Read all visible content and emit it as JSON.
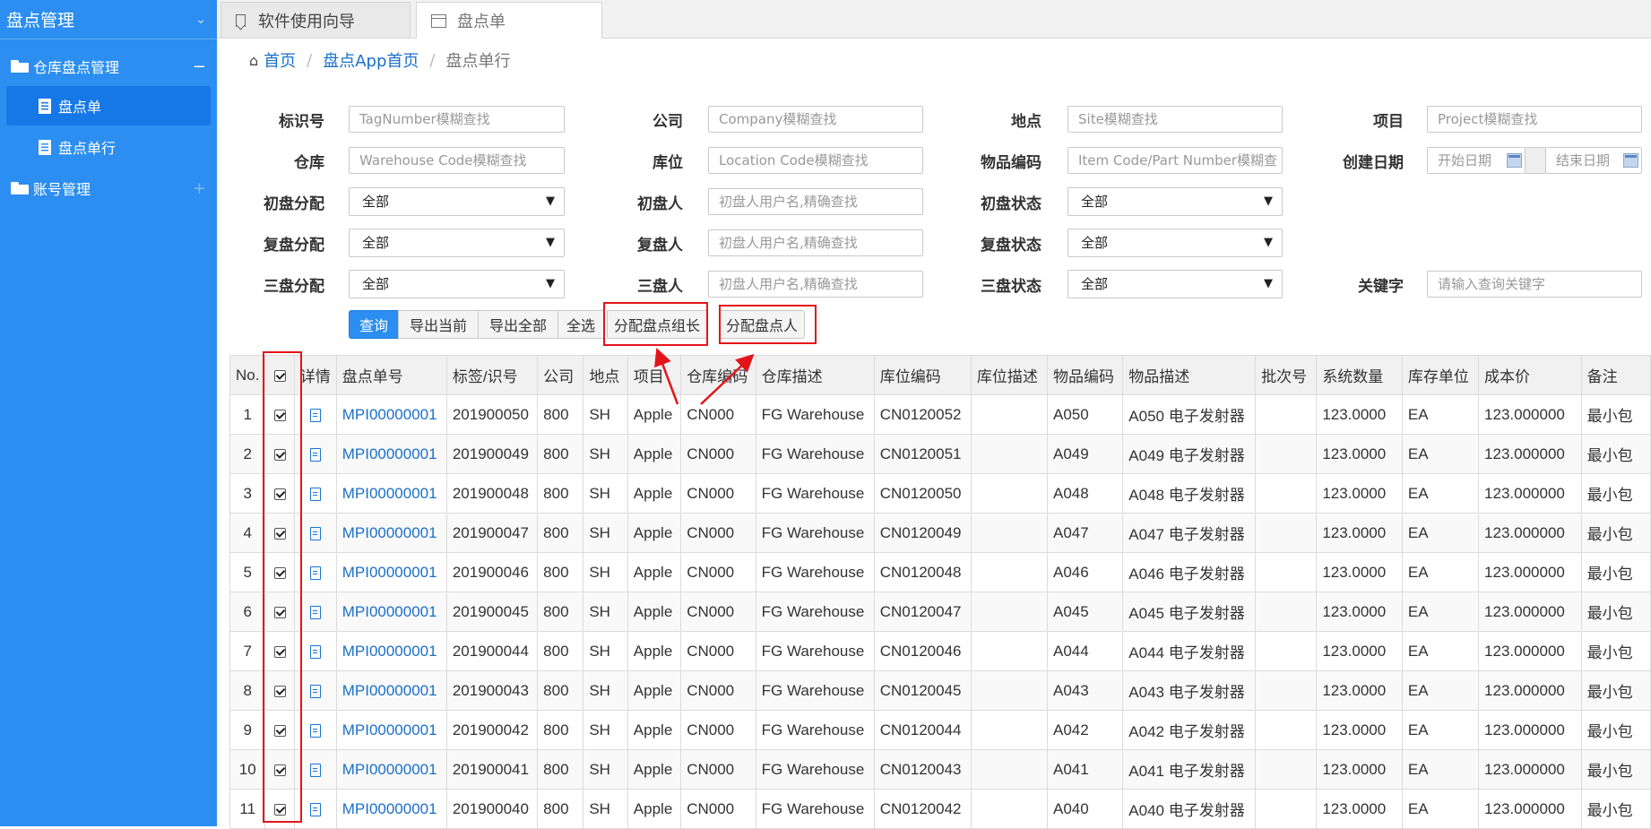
{
  "sidebar": {
    "title": "盘点管理",
    "groups": [
      {
        "label": "仓库盘点管理",
        "sign": "−",
        "items": [
          {
            "label": "盘点单"
          },
          {
            "label": "盘点单行"
          }
        ]
      },
      {
        "label": "账号管理",
        "sign": "+"
      }
    ]
  },
  "tabs": [
    {
      "label": "软件使用向导"
    },
    {
      "label": "盘点单"
    }
  ],
  "breadcrumb": {
    "home": "首页",
    "parent": "盘点App首页",
    "current": "盘点单行"
  },
  "filters": {
    "tag_label": "标识号",
    "tag_ph": "TagNumber模糊查找",
    "company_label": "公司",
    "company_ph": "Company模糊查找",
    "site_label": "地点",
    "site_ph": "Site模糊查找",
    "project_label": "项目",
    "project_ph": "Project模糊查找",
    "warehouse_label": "仓库",
    "warehouse_ph": "Warehouse Code模糊查找",
    "location_label": "库位",
    "location_ph": "Location Code模糊查找",
    "item_label": "物品编码",
    "item_ph": "Item Code/Part Number模糊查",
    "created_label": "创建日期",
    "start_ph": "开始日期",
    "end_ph": "结束日期",
    "first_assign_label": "初盘分配",
    "first_assign_value": "全部",
    "first_user_label": "初盘人",
    "first_user_ph": "初盘人用户名,精确查找",
    "first_status_label": "初盘状态",
    "first_status_value": "全部",
    "second_assign_label": "复盘分配",
    "second_assign_value": "全部",
    "second_user_label": "复盘人",
    "second_user_ph": "初盘人用户名,精确查找",
    "second_status_label": "复盘状态",
    "second_status_value": "全部",
    "third_assign_label": "三盘分配",
    "third_assign_value": "全部",
    "third_user_label": "三盘人",
    "third_user_ph": "初盘人用户名,精确查找",
    "third_status_label": "三盘状态",
    "third_status_value": "全部",
    "keyword_label": "关键字",
    "keyword_ph": "请输入查询关键字"
  },
  "toolbar": {
    "query": "查询",
    "export_current": "导出当前",
    "export_all": "导出全部",
    "select_all": "全选",
    "assign_leader": "分配盘点组长",
    "assign_counter": "分配盘点人"
  },
  "table": {
    "headers": [
      "No.",
      "",
      "详情",
      "盘点单号",
      "标签/识号",
      "公司",
      "地点",
      "项目",
      "仓库编码",
      "仓库描述",
      "库位编码",
      "库位描述",
      "物品编码",
      "物品描述",
      "批次号",
      "系统数量",
      "库存单位",
      "成本价",
      "备注"
    ],
    "rows": [
      [
        "1",
        "MPI00000001",
        "201900050",
        "800",
        "SH",
        "Apple",
        "CN000",
        "FG Warehouse",
        "CN0120052",
        "",
        "A050",
        "A050 电子发射器",
        "",
        "123.0000",
        "EA",
        "123.000000",
        "最小包"
      ],
      [
        "2",
        "MPI00000001",
        "201900049",
        "800",
        "SH",
        "Apple",
        "CN000",
        "FG Warehouse",
        "CN0120051",
        "",
        "A049",
        "A049 电子发射器",
        "",
        "123.0000",
        "EA",
        "123.000000",
        "最小包"
      ],
      [
        "3",
        "MPI00000001",
        "201900048",
        "800",
        "SH",
        "Apple",
        "CN000",
        "FG Warehouse",
        "CN0120050",
        "",
        "A048",
        "A048 电子发射器",
        "",
        "123.0000",
        "EA",
        "123.000000",
        "最小包"
      ],
      [
        "4",
        "MPI00000001",
        "201900047",
        "800",
        "SH",
        "Apple",
        "CN000",
        "FG Warehouse",
        "CN0120049",
        "",
        "A047",
        "A047 电子发射器",
        "",
        "123.0000",
        "EA",
        "123.000000",
        "最小包"
      ],
      [
        "5",
        "MPI00000001",
        "201900046",
        "800",
        "SH",
        "Apple",
        "CN000",
        "FG Warehouse",
        "CN0120048",
        "",
        "A046",
        "A046 电子发射器",
        "",
        "123.0000",
        "EA",
        "123.000000",
        "最小包"
      ],
      [
        "6",
        "MPI00000001",
        "201900045",
        "800",
        "SH",
        "Apple",
        "CN000",
        "FG Warehouse",
        "CN0120047",
        "",
        "A045",
        "A045 电子发射器",
        "",
        "123.0000",
        "EA",
        "123.000000",
        "最小包"
      ],
      [
        "7",
        "MPI00000001",
        "201900044",
        "800",
        "SH",
        "Apple",
        "CN000",
        "FG Warehouse",
        "CN0120046",
        "",
        "A044",
        "A044 电子发射器",
        "",
        "123.0000",
        "EA",
        "123.000000",
        "最小包"
      ],
      [
        "8",
        "MPI00000001",
        "201900043",
        "800",
        "SH",
        "Apple",
        "CN000",
        "FG Warehouse",
        "CN0120045",
        "",
        "A043",
        "A043 电子发射器",
        "",
        "123.0000",
        "EA",
        "123.000000",
        "最小包"
      ],
      [
        "9",
        "MPI00000001",
        "201900042",
        "800",
        "SH",
        "Apple",
        "CN000",
        "FG Warehouse",
        "CN0120044",
        "",
        "A042",
        "A042 电子发射器",
        "",
        "123.0000",
        "EA",
        "123.000000",
        "最小包"
      ],
      [
        "10",
        "MPI00000001",
        "201900041",
        "800",
        "SH",
        "Apple",
        "CN000",
        "FG Warehouse",
        "CN0120043",
        "",
        "A041",
        "A041 电子发射器",
        "",
        "123.0000",
        "EA",
        "123.000000",
        "最小包"
      ],
      [
        "11",
        "MPI00000001",
        "201900040",
        "800",
        "SH",
        "Apple",
        "CN000",
        "FG Warehouse",
        "CN0120042",
        "",
        "A040",
        "A040 电子发射器",
        "",
        "123.0000",
        "EA",
        "123.000000",
        "最小包"
      ]
    ]
  },
  "colors": {
    "sidebar": "#2b8ef0",
    "sidebar_active": "#1677e6",
    "link": "#1a6fc9",
    "annotation": "#e3151a"
  }
}
